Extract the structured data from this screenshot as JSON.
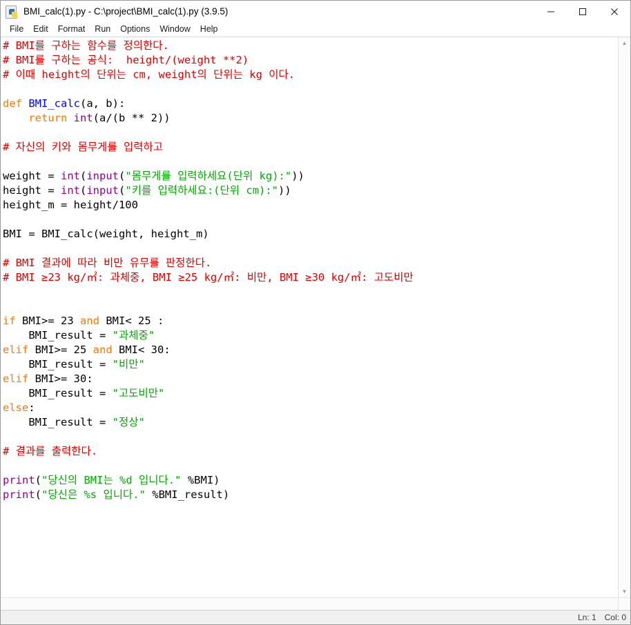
{
  "window": {
    "title": "BMI_calc(1).py - C:\\project\\BMI_calc(1).py (3.9.5)",
    "icon": "python-file-icon",
    "minimize_label": "─",
    "maximize_label": "□",
    "close_label": "✕"
  },
  "menubar": {
    "items": [
      {
        "label": "File"
      },
      {
        "label": "Edit"
      },
      {
        "label": "Format"
      },
      {
        "label": "Run"
      },
      {
        "label": "Options"
      },
      {
        "label": "Window"
      },
      {
        "label": "Help"
      }
    ]
  },
  "editor": {
    "language": "python",
    "colors": {
      "comment": "#DD0000",
      "keyword": "#FF7700",
      "builtin": "#900090",
      "string": "#00AA00",
      "definition": "#0000FF",
      "plain": "#000000",
      "background": "#FFFFFF"
    },
    "lines": [
      [
        {
          "t": "# BMI를 구하는 함수를 정의한다.",
          "c": "comment"
        }
      ],
      [
        {
          "t": "# BMI를 구하는 공식:  height/(weight **2)",
          "c": "comment"
        }
      ],
      [
        {
          "t": "# 이때 height의 단위는 cm, weight의 단위는 kg 이다.",
          "c": "comment"
        }
      ],
      [
        {
          "t": "",
          "c": "plain"
        }
      ],
      [
        {
          "t": "def ",
          "c": "keyword"
        },
        {
          "t": "BMI_calc",
          "c": "definition"
        },
        {
          "t": "(a, b):",
          "c": "plain"
        }
      ],
      [
        {
          "t": "    return ",
          "c": "keyword"
        },
        {
          "t": "int",
          "c": "builtin"
        },
        {
          "t": "(a/(b ** 2))",
          "c": "plain"
        }
      ],
      [
        {
          "t": "",
          "c": "plain"
        }
      ],
      [
        {
          "t": "# 자신의 키와 몸무게를 입력하고",
          "c": "comment"
        }
      ],
      [
        {
          "t": "",
          "c": "plain"
        }
      ],
      [
        {
          "t": "weight = ",
          "c": "plain"
        },
        {
          "t": "int",
          "c": "builtin"
        },
        {
          "t": "(",
          "c": "plain"
        },
        {
          "t": "input",
          "c": "builtin"
        },
        {
          "t": "(",
          "c": "plain"
        },
        {
          "t": "\"몸무게를 입력하세요(단위 kg):\"",
          "c": "string"
        },
        {
          "t": "))",
          "c": "plain"
        }
      ],
      [
        {
          "t": "height = ",
          "c": "plain"
        },
        {
          "t": "int",
          "c": "builtin"
        },
        {
          "t": "(",
          "c": "plain"
        },
        {
          "t": "input",
          "c": "builtin"
        },
        {
          "t": "(",
          "c": "plain"
        },
        {
          "t": "\"키를 입력하세요:(단위 cm):\"",
          "c": "string"
        },
        {
          "t": "))",
          "c": "plain"
        }
      ],
      [
        {
          "t": "height_m = height/100",
          "c": "plain"
        }
      ],
      [
        {
          "t": "",
          "c": "plain"
        }
      ],
      [
        {
          "t": "BMI = BMI_calc(weight, height_m)",
          "c": "plain"
        }
      ],
      [
        {
          "t": "",
          "c": "plain"
        }
      ],
      [
        {
          "t": "# BMI 결과에 따라 비만 유무를 판정한다.",
          "c": "comment"
        }
      ],
      [
        {
          "t": "# BMI ≥23 kg/㎡: 과체중, BMI ≥25 kg/㎡: 비만, BMI ≥30 kg/㎡: 고도비만",
          "c": "comment"
        }
      ],
      [
        {
          "t": "",
          "c": "plain"
        }
      ],
      [
        {
          "t": "",
          "c": "plain"
        }
      ],
      [
        {
          "t": "if ",
          "c": "keyword"
        },
        {
          "t": "BMI>= 23 ",
          "c": "plain"
        },
        {
          "t": "and ",
          "c": "keyword"
        },
        {
          "t": "BMI< 25 :",
          "c": "plain"
        }
      ],
      [
        {
          "t": "    BMI_result = ",
          "c": "plain"
        },
        {
          "t": "\"과체중\"",
          "c": "string"
        }
      ],
      [
        {
          "t": "elif ",
          "c": "keyword"
        },
        {
          "t": "BMI>= 25 ",
          "c": "plain"
        },
        {
          "t": "and ",
          "c": "keyword"
        },
        {
          "t": "BMI< 30:",
          "c": "plain"
        }
      ],
      [
        {
          "t": "    BMI_result = ",
          "c": "plain"
        },
        {
          "t": "\"비만\"",
          "c": "string"
        }
      ],
      [
        {
          "t": "elif ",
          "c": "keyword"
        },
        {
          "t": "BMI>= 30:",
          "c": "plain"
        }
      ],
      [
        {
          "t": "    BMI_result = ",
          "c": "plain"
        },
        {
          "t": "\"고도비만\"",
          "c": "string"
        }
      ],
      [
        {
          "t": "else",
          "c": "keyword"
        },
        {
          "t": ":",
          "c": "plain"
        }
      ],
      [
        {
          "t": "    BMI_result = ",
          "c": "plain"
        },
        {
          "t": "\"정상\"",
          "c": "string"
        }
      ],
      [
        {
          "t": "",
          "c": "plain"
        }
      ],
      [
        {
          "t": "# 결과를 출력한다.",
          "c": "comment"
        }
      ],
      [
        {
          "t": "",
          "c": "plain"
        }
      ],
      [
        {
          "t": "print",
          "c": "builtin"
        },
        {
          "t": "(",
          "c": "plain"
        },
        {
          "t": "\"당신의 BMI는 %d 입니다.\"",
          "c": "string"
        },
        {
          "t": " %BMI)",
          "c": "plain"
        }
      ],
      [
        {
          "t": "print",
          "c": "builtin"
        },
        {
          "t": "(",
          "c": "plain"
        },
        {
          "t": "\"당신은 %s 입니다.\"",
          "c": "string"
        },
        {
          "t": " %BMI_result)",
          "c": "plain"
        }
      ]
    ]
  },
  "statusbar": {
    "line_label": "Ln: 1",
    "col_label": "Col: 0"
  }
}
